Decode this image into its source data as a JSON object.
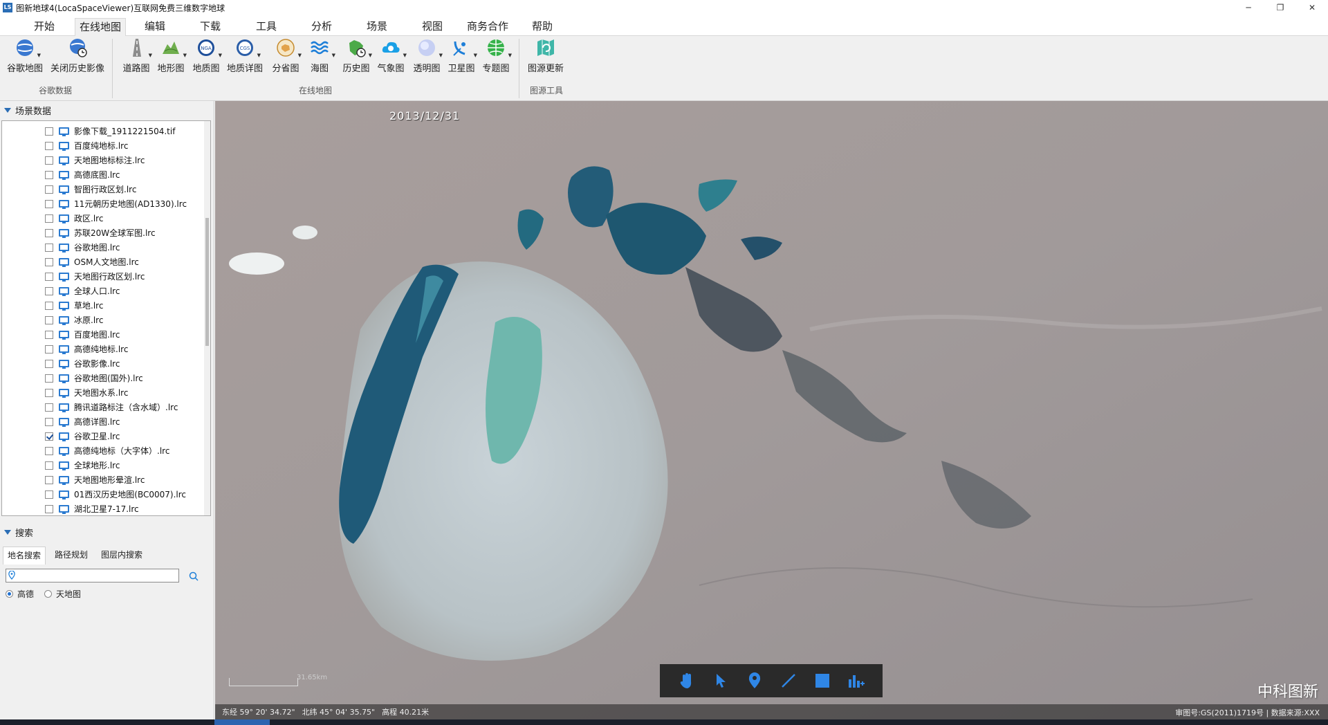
{
  "window": {
    "title": "图新地球4(LocaSpaceViewer)互联网免费三维数字地球",
    "app_icon": "LS",
    "buttons": {
      "minimize": "─",
      "restore": "❐",
      "close": "✕"
    }
  },
  "menu": {
    "tabs": [
      "开始",
      "在线地图",
      "编辑",
      "下载",
      "工具",
      "分析",
      "场景",
      "视图",
      "商务合作",
      "帮助"
    ],
    "active": "在线地图"
  },
  "ribbon": {
    "buttons": [
      {
        "label": "谷歌地图",
        "icon": "google-globe-icon",
        "caret": true
      },
      {
        "label": "关闭历史影像",
        "icon": "history-imagery-icon",
        "caret": false
      },
      {
        "label": "道路图",
        "icon": "road-map-icon",
        "caret": true
      },
      {
        "label": "地形图",
        "icon": "terrain-map-icon",
        "caret": true
      },
      {
        "label": "地质图",
        "icon": "nga-geology-icon",
        "caret": true
      },
      {
        "label": "地质详图",
        "icon": "cgs-geology-detail-icon",
        "caret": true
      },
      {
        "label": "分省图",
        "icon": "province-map-icon",
        "caret": true
      },
      {
        "label": "海图",
        "icon": "sea-chart-icon",
        "caret": true
      },
      {
        "label": "历史图",
        "icon": "history-map-icon",
        "caret": true
      },
      {
        "label": "气象图",
        "icon": "weather-map-icon",
        "caret": true
      },
      {
        "label": "透明图",
        "icon": "transparent-map-icon",
        "caret": true
      },
      {
        "label": "卫星图",
        "icon": "satellite-map-icon",
        "caret": true
      },
      {
        "label": "专题图",
        "icon": "thematic-map-icon",
        "caret": true
      },
      {
        "label": "图源更新",
        "icon": "source-update-icon",
        "caret": false
      }
    ],
    "groups": [
      "谷歌数据",
      "在线地图",
      "图源工具"
    ]
  },
  "scene_panel": {
    "title": "场景数据",
    "items": [
      {
        "label": "影像下载_1911221504.tif",
        "checked": false
      },
      {
        "label": "百度纯地标.lrc",
        "checked": false
      },
      {
        "label": "天地图地标标注.lrc",
        "checked": false
      },
      {
        "label": "高德底图.lrc",
        "checked": false
      },
      {
        "label": "智图行政区划.lrc",
        "checked": false
      },
      {
        "label": "11元朝历史地图(AD1330).lrc",
        "checked": false
      },
      {
        "label": "政区.lrc",
        "checked": false
      },
      {
        "label": "苏联20W全球军图.lrc",
        "checked": false
      },
      {
        "label": "谷歌地图.lrc",
        "checked": false
      },
      {
        "label": "OSM人文地图.lrc",
        "checked": false
      },
      {
        "label": "天地图行政区划.lrc",
        "checked": false
      },
      {
        "label": "全球人口.lrc",
        "checked": false
      },
      {
        "label": "草地.lrc",
        "checked": false
      },
      {
        "label": "冰原.lrc",
        "checked": false
      },
      {
        "label": "百度地图.lrc",
        "checked": false
      },
      {
        "label": "高德纯地标.lrc",
        "checked": false
      },
      {
        "label": "谷歌影像.lrc",
        "checked": false
      },
      {
        "label": "谷歌地图(国外).lrc",
        "checked": false
      },
      {
        "label": "天地图水系.lrc",
        "checked": false
      },
      {
        "label": "腾讯道路标注（含水域）.lrc",
        "checked": false
      },
      {
        "label": "高德详图.lrc",
        "checked": false
      },
      {
        "label": "谷歌卫星.lrc",
        "checked": true
      },
      {
        "label": "高德纯地标（大字体）.lrc",
        "checked": false
      },
      {
        "label": "全球地形.lrc",
        "checked": false
      },
      {
        "label": "天地图地形晕渲.lrc",
        "checked": false
      },
      {
        "label": "01西汉历史地图(BC0007).lrc",
        "checked": false
      },
      {
        "label": "湖北卫星7-17.lrc",
        "checked": false
      }
    ]
  },
  "search_panel": {
    "title": "搜索",
    "tabs": [
      "地名搜索",
      "路径规划",
      "图层内搜索"
    ],
    "active_tab": "地名搜索",
    "input_value": "",
    "input_placeholder": "",
    "sources": [
      {
        "label": "高德",
        "selected": true
      },
      {
        "label": "天地图",
        "selected": false
      }
    ]
  },
  "map": {
    "date": "2013/12/31",
    "watermark": "中科图新",
    "scale_text": "31.65km",
    "coords": {
      "lon": "东经 59° 20' 34.72\"",
      "lat": "北纬 45° 04' 35.75\"",
      "alt": "高程 40.21米"
    },
    "status_right": "审图号:GS(2011)1719号 | 数据来源:XXX",
    "tools": [
      "pan-hand-icon",
      "select-arrow-icon",
      "place-marker-icon",
      "draw-line-icon",
      "draw-polygon-icon",
      "statistics-icon"
    ]
  }
}
